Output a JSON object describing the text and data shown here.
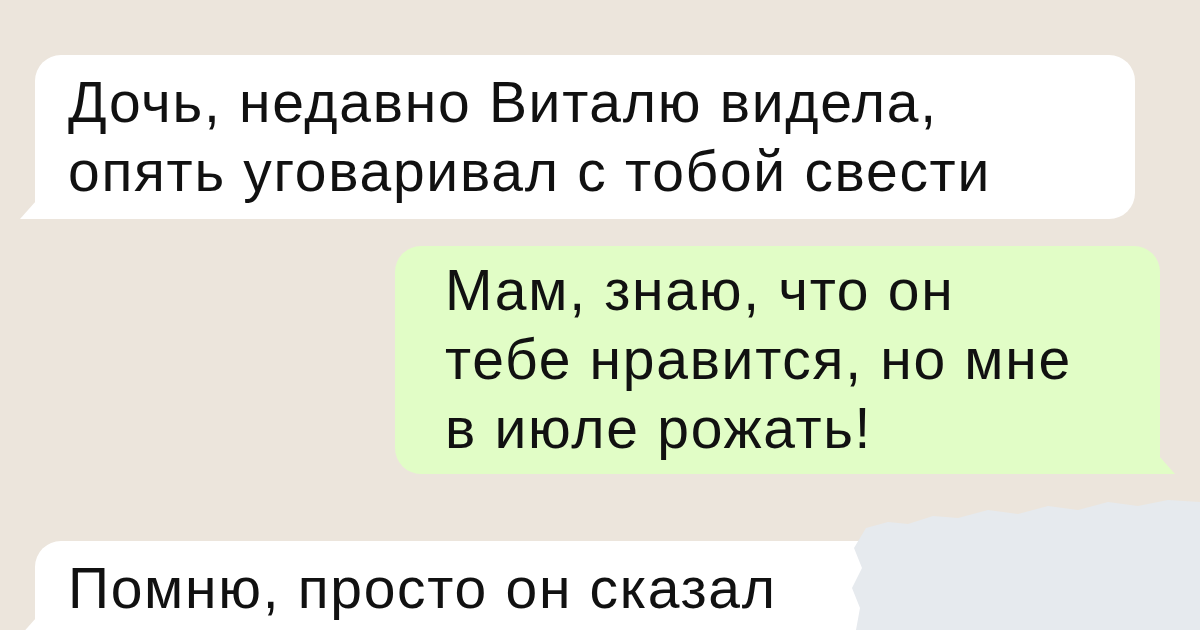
{
  "messages": [
    {
      "kind": "incoming",
      "lines": [
        "Дочь, недавно Виталю видела,",
        "опять уговаривал с тобой свести"
      ]
    },
    {
      "kind": "outgoing",
      "lines": [
        "Мам, знаю, что он",
        "тебе нравится, но мне",
        "в июле рожать!"
      ]
    },
    {
      "kind": "incoming",
      "lines": [
        "Помню, просто он сказал"
      ]
    }
  ]
}
